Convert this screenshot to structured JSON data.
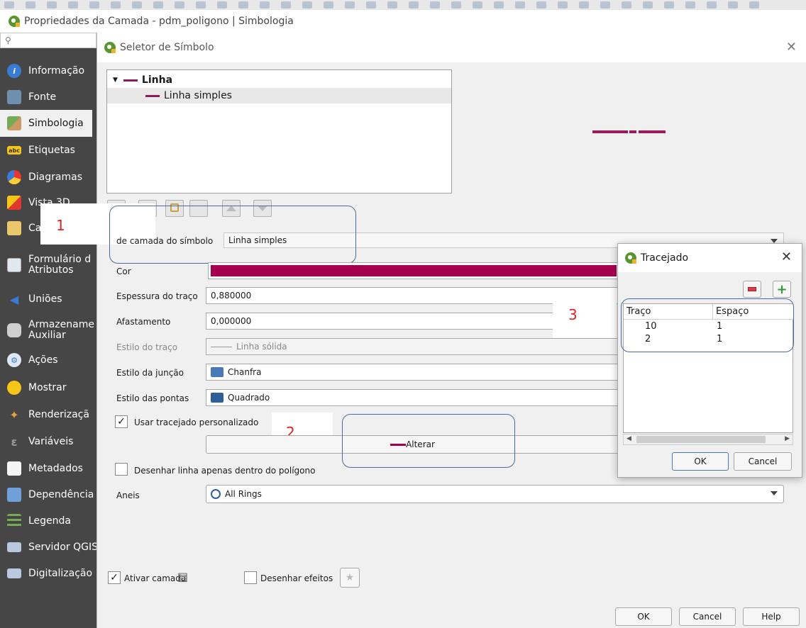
{
  "window": {
    "title": "Propriedades da Camada - pdm_poligono | Simbologia"
  },
  "sidebar": {
    "search_placeholder": "",
    "items": [
      {
        "label": "Informação",
        "icon": "info-icon"
      },
      {
        "label": "Fonte",
        "icon": "source-icon"
      },
      {
        "label": "Simbologia",
        "icon": "symbology-icon"
      },
      {
        "label": "Etiquetas",
        "icon": "labels-icon"
      },
      {
        "label": "Diagramas",
        "icon": "diagrams-icon"
      },
      {
        "label": "Vista 3D",
        "icon": "cube-3d-icon"
      },
      {
        "label": "Ca",
        "icon": "fields-icon"
      },
      {
        "label": "Formulário d",
        "label2": "Atributos",
        "icon": "form-icon"
      },
      {
        "label": "Uniões",
        "icon": "joins-icon"
      },
      {
        "label": "Armazename",
        "label2": "Auxiliar",
        "icon": "storage-icon"
      },
      {
        "label": "Ações",
        "icon": "actions-icon"
      },
      {
        "label": "Mostrar",
        "icon": "display-icon"
      },
      {
        "label": "Renderizaçã",
        "icon": "rendering-icon"
      },
      {
        "label": "Variáveis",
        "icon": "variables-icon"
      },
      {
        "label": "Metadados",
        "icon": "metadata-icon"
      },
      {
        "label": "Dependência",
        "icon": "dependencies-icon"
      },
      {
        "label": "Legenda",
        "icon": "legend-icon"
      },
      {
        "label": "Servidor QGIS",
        "icon": "server-icon"
      },
      {
        "label": "Digitalização",
        "icon": "digitizing-icon"
      }
    ]
  },
  "symbol_dialog": {
    "title": "Seletor de Símbolo",
    "tree": {
      "parent": "Linha",
      "child": "Linha simples"
    },
    "symbol_layer_type_label": "de camada do símbolo",
    "symbol_layer_type_value": "Linha simples",
    "color_label": "Cor",
    "color_value": "#a50050",
    "stroke_width_label": "Espessura do traço",
    "stroke_width_value": "0,880000",
    "offset_label": "Afastamento",
    "offset_value": "0,000000",
    "stroke_style_label": "Estilo do traço",
    "stroke_style_value": "Linha sólida",
    "join_style_label": "Estilo da junção",
    "join_style_value": "Chanfra",
    "cap_style_label": "Estilo das pontas",
    "cap_style_value": "Quadrado",
    "custom_dash_label": "Usar tracejado personalizado",
    "change_button": "Alterar",
    "inside_polygon_label": "Desenhar linha apenas dentro do polígono",
    "rings_label": "Aneis",
    "rings_value": "All Rings",
    "enable_layer_label": "Ativar camada",
    "draw_effects_label": "Desenhar efeitos",
    "ok": "OK",
    "cancel": "Cancel",
    "help": "Help"
  },
  "annotations": {
    "n1": "1",
    "n2": "2",
    "n3": "3"
  },
  "dash_dialog": {
    "title": "Tracejado",
    "col_dash": "Traço",
    "col_space": "Espaço",
    "rows": [
      {
        "dash": "10",
        "space": "1"
      },
      {
        "dash": "2",
        "space": "1"
      }
    ],
    "ok": "OK",
    "cancel": "Cancel"
  }
}
